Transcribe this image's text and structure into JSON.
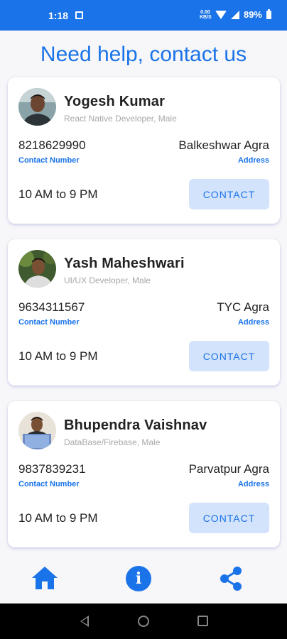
{
  "status_bar": {
    "time": "1:18",
    "net_speed_top": "0.00",
    "net_speed_bottom": "KB/S",
    "battery": "89%"
  },
  "title": "Need help, contact us",
  "contacts": [
    {
      "name": "Yogesh Kumar",
      "role": "React Native Developer, Male",
      "phone": "8218629990",
      "phone_label": "Contact Number",
      "address": "Balkeshwar Agra",
      "address_label": "Address",
      "hours": "10 AM to 9 PM",
      "button": "CONTACT"
    },
    {
      "name": "Yash Maheshwari",
      "role": "UI/UX Developer, Male",
      "phone": "9634311567",
      "phone_label": "Contact Number",
      "address": "TYC Agra",
      "address_label": "Address",
      "hours": "10 AM to 9 PM",
      "button": "CONTACT"
    },
    {
      "name": "Bhupendra Vaishnav",
      "role": "DataBase/Firebase, Male",
      "phone": "9837839231",
      "phone_label": "Contact Number",
      "address": "Parvatpur Agra",
      "address_label": "Address",
      "hours": "10 AM to 9 PM",
      "button": "CONTACT"
    }
  ],
  "bottom_nav": {
    "items": [
      {
        "icon": "home-icon"
      },
      {
        "icon": "info-icon",
        "glyph": "i"
      },
      {
        "icon": "share-icon"
      }
    ]
  },
  "colors": {
    "accent": "#1a73e8",
    "button_bg": "#d3e3fb",
    "background": "#f7f7f9"
  }
}
